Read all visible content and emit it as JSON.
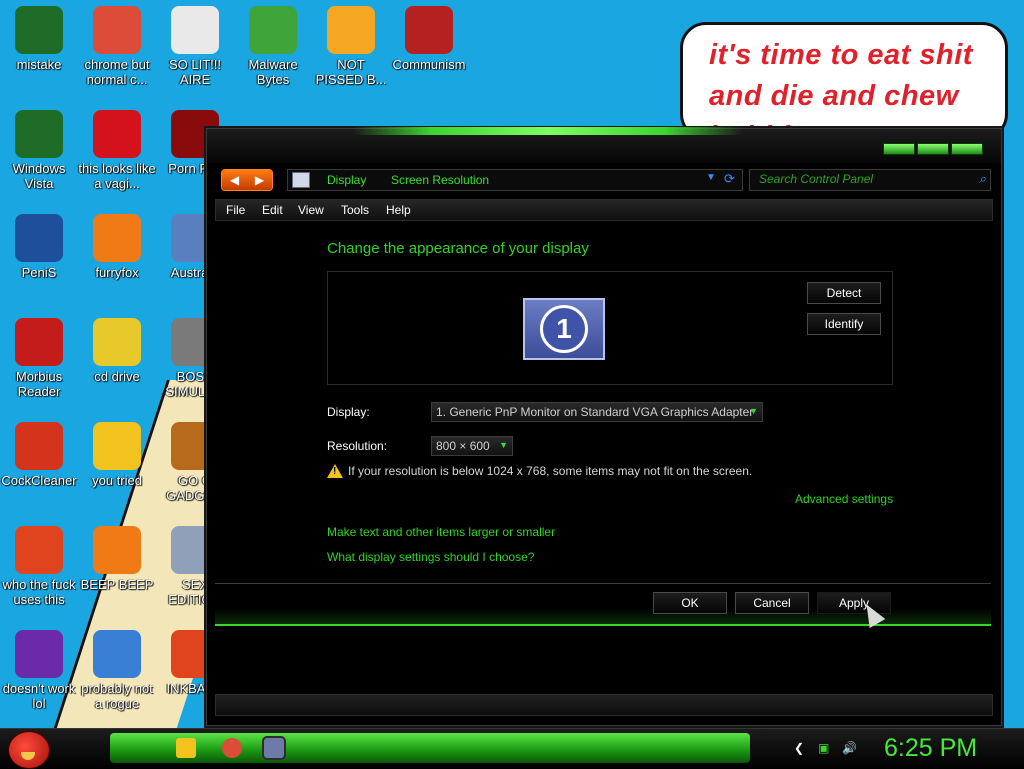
{
  "desktop": {
    "icons": [
      {
        "label": "mistake",
        "icon": "mistake-icon",
        "color": "#1f6b28"
      },
      {
        "label": "chrome but normal c...",
        "icon": "chrome-icon",
        "color": "#dd4b39"
      },
      {
        "label": "SO LIT!!! AIRE",
        "icon": "solitaire-icon",
        "color": "#e9e9e9"
      },
      {
        "label": "Malware Bytes",
        "icon": "malwarebytes-icon",
        "color": "#3fa43a"
      },
      {
        "label": "NOT PISSED B...",
        "icon": "angry-birds-pig-icon",
        "color": "#f5a623"
      },
      {
        "label": "Communism",
        "icon": "communism-icon",
        "color": "#b52121"
      },
      {
        "label": "Windows Vista",
        "icon": "recycle-bin-icon",
        "color": "#1f6b28"
      },
      {
        "label": "this looks like a vagi...",
        "icon": "opera-icon",
        "color": "#d3121b"
      },
      {
        "label": "Porn Pl...",
        "icon": "flash-icon",
        "color": "#8a0b0b"
      },
      {
        "label": "PeniS",
        "icon": "photoshop-icon",
        "color": "#1d4f9a"
      },
      {
        "label": "furryfox",
        "icon": "firefox-icon",
        "color": "#f07a16"
      },
      {
        "label": "Austra...",
        "icon": "spider-solitaire-icon",
        "color": "#5a7fbf"
      },
      {
        "label": "Morbius Reader",
        "icon": "pdf-reader-icon",
        "color": "#c41b1b"
      },
      {
        "label": "cd drive",
        "icon": "cd-drive-icon",
        "color": "#e7c92c"
      },
      {
        "label": "BOSN SIMULA...",
        "icon": "mine-icon",
        "color": "#7a7a7a"
      },
      {
        "label": "CockCleaner",
        "icon": "ccleaner-icon",
        "color": "#d4341b"
      },
      {
        "label": "you tried",
        "icon": "star-icon",
        "color": "#f2c21e"
      },
      {
        "label": "GO G GADGE...",
        "icon": "briefcase-icon",
        "color": "#b86a1c"
      },
      {
        "label": "who the fuck uses this",
        "icon": "flash-player-icon",
        "color": "#e0441f"
      },
      {
        "label": "BEEP BEEP",
        "icon": "vlc-icon",
        "color": "#f07a16"
      },
      {
        "label": "SEX EDITIC...",
        "icon": "hx-editor-icon",
        "color": "#8fa0b8"
      },
      {
        "label": "doesn't work lol",
        "icon": "yahoo-messenger-icon",
        "color": "#6b2aa8"
      },
      {
        "label": "probably not a rogue",
        "icon": "gears-icon",
        "color": "#3a7fd6"
      },
      {
        "label": "INKBAL...",
        "icon": "ink-ball-icon",
        "color": "#e0441f"
      }
    ],
    "bubble_text": "it's time to eat shit and die and chew bubble gum"
  },
  "window": {
    "address": {
      "crumb1": "Display",
      "crumb2": "Screen Resolution"
    },
    "search_placeholder": "Search Control Panel",
    "menu": [
      "File",
      "Edit",
      "View",
      "Tools",
      "Help"
    ],
    "heading": "Change the appearance of your display",
    "monitor_number": "1",
    "detect_label": "Detect",
    "identify_label": "Identify",
    "display_label": "Display:",
    "display_value": "1. Generic PnP Monitor on Standard VGA Graphics Adapter",
    "resolution_label": "Resolution:",
    "resolution_value": "800 × 600",
    "warning_text": "If your resolution is below 1024 x 768, some items may not fit on the screen.",
    "advanced_link": "Advanced settings",
    "link1": "Make text and other items larger or smaller",
    "link2": "What display settings should I choose?",
    "ok_label": "OK",
    "cancel_label": "Cancel",
    "apply_label": "Apply"
  },
  "taskbar": {
    "clock": "6:25 PM",
    "accent": "#47e83a"
  }
}
